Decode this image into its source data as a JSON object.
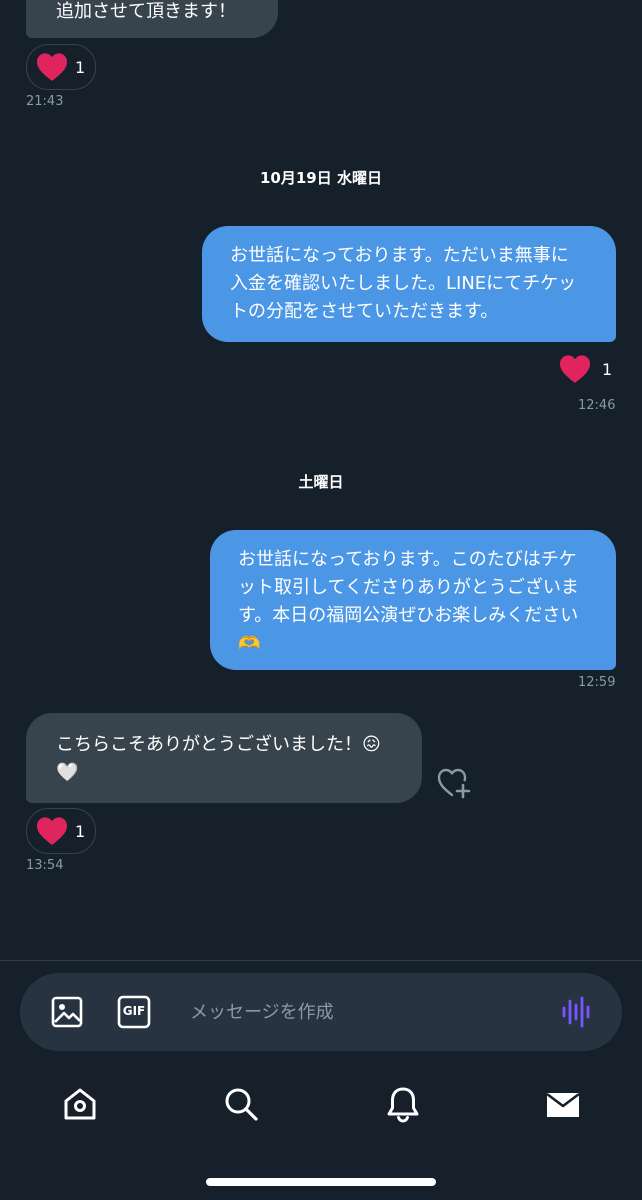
{
  "messages": {
    "m1": {
      "text": "追加させて頂きます！",
      "reaction_count": "1",
      "time": "21:43"
    },
    "date1": "10月19日 水曜日",
    "m2": {
      "lines": [
        "お世話になっております。ただいま無事に",
        "入金を確認いたしました。LINEにてチケッ",
        "トの分配をさせていただきます。"
      ],
      "reaction_count": "1",
      "time": "12:46"
    },
    "date2": "土曜日",
    "m3": {
      "lines": [
        "お世話になっております。このたびはチケ",
        "ット取引してくださりありがとうございま",
        "す。本日の福岡公演ぜひお楽しみください",
        "🫶"
      ],
      "time": "12:59"
    },
    "m4": {
      "lines": [
        "こちらこそありがとうございました！😖",
        "🤍"
      ],
      "reaction_count": "1",
      "time": "13:54"
    }
  },
  "composer": {
    "placeholder": "メッセージを作成",
    "gif_label": "GIF"
  },
  "icons": {
    "reaction": "heart-icon",
    "add_reaction": "heart-plus-icon",
    "image": "image-icon",
    "gif": "gif-icon",
    "voice": "voice-wave-icon",
    "nav": [
      "home-icon",
      "search-icon",
      "bell-icon",
      "mail-icon"
    ]
  },
  "colors": {
    "background": "#15202b",
    "incoming_bubble": "#38444d",
    "outgoing_bubble": "#4b97e6",
    "heart": "#e0245e",
    "accent_voice": "#7856ff"
  }
}
